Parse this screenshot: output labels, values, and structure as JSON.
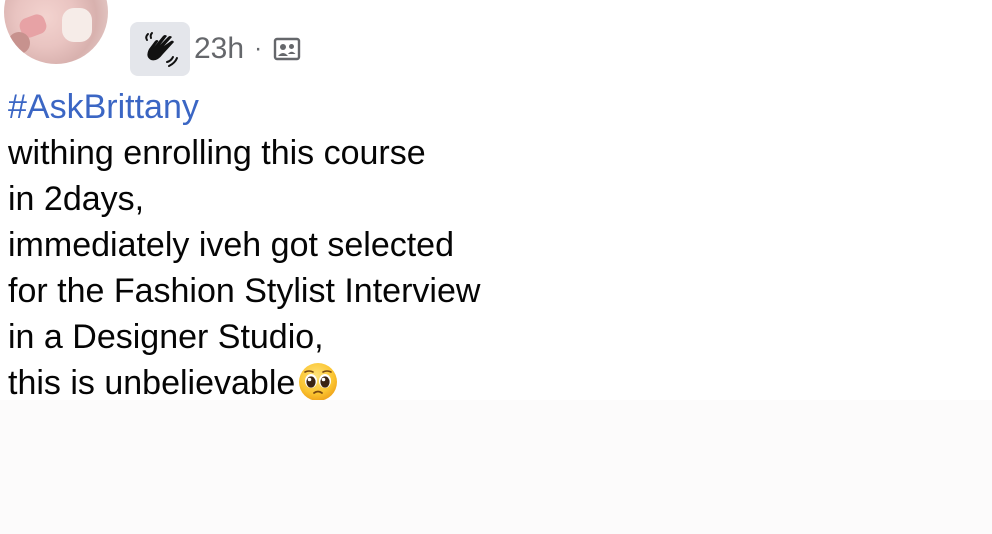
{
  "post": {
    "time_label": "23h",
    "separator": "·",
    "audience_icon": "friends-group-icon",
    "badge_icon": "waving-hand-icon",
    "hashtag": "#AskBrittany",
    "lines": [
      "withing enrolling this course",
      "in 2days,",
      "immediately iveh got selected",
      "for the Fashion Stylist Interview",
      "in a Designer Studio,",
      "this is unbelievable"
    ],
    "trailing_emoji": "pleading-face-emoji"
  },
  "colors": {
    "hashtag": "#3b66c4",
    "meta_text": "#65676b",
    "badge_bg": "#e4e6eb",
    "body_text": "#050505"
  }
}
